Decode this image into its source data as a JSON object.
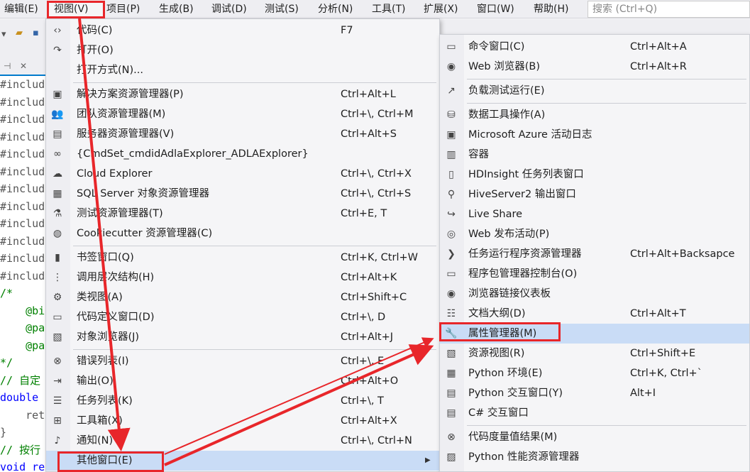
{
  "menubar": {
    "items": [
      {
        "label": "编辑(E)"
      },
      {
        "label": "视图(V)"
      },
      {
        "label": "项目(P)"
      },
      {
        "label": "生成(B)"
      },
      {
        "label": "调试(D)"
      },
      {
        "label": "测试(S)"
      },
      {
        "label": "分析(N)"
      },
      {
        "label": "工具(T)"
      },
      {
        "label": "扩展(X)"
      },
      {
        "label": "窗口(W)"
      },
      {
        "label": "帮助(H)"
      }
    ],
    "search_placeholder": "搜索 (Ctrl+Q)"
  },
  "doc_tab": {
    "pin_glyph": "⊣",
    "close_glyph": "✕"
  },
  "code_lines": [
    "#include",
    "#include",
    "#include",
    "#include",
    "#include",
    "#include",
    "#include",
    "#include",
    "#include",
    "#include",
    "#include",
    "#include",
    "/*",
    "    @bi",
    "    @pa",
    "    @pa",
    "*/",
    "// 自定",
    "double",
    "    ret",
    "}",
    "// 按行",
    "void re"
  ],
  "view_menu": {
    "items": [
      {
        "icon": "code-icon",
        "glyph": "‹›",
        "label": "代码(C)",
        "shortcut": "F7"
      },
      {
        "icon": "open-icon",
        "glyph": "↷",
        "label": "打开(O)",
        "shortcut": ""
      },
      {
        "icon": "",
        "glyph": "",
        "label": "打开方式(N)...",
        "shortcut": ""
      },
      {
        "icon": "solution-explorer-icon",
        "glyph": "▣",
        "label": "解决方案资源管理器(P)",
        "shortcut": "Ctrl+Alt+L"
      },
      {
        "icon": "team-explorer-icon",
        "glyph": "👥",
        "label": "团队资源管理器(M)",
        "shortcut": "Ctrl+\\, Ctrl+M"
      },
      {
        "icon": "server-explorer-icon",
        "glyph": "▤",
        "label": "服务器资源管理器(V)",
        "shortcut": "Ctrl+Alt+S"
      },
      {
        "icon": "adla-explorer-icon",
        "glyph": "∞",
        "label": "{CmdSet_cmdidAdlaExplorer_ADLAExplorer}",
        "shortcut": ""
      },
      {
        "icon": "cloud-icon",
        "glyph": "☁",
        "label": "Cloud Explorer",
        "shortcut": "Ctrl+\\, Ctrl+X"
      },
      {
        "icon": "sql-server-icon",
        "glyph": "▦",
        "label": "SQL Server 对象资源管理器",
        "shortcut": "Ctrl+\\, Ctrl+S"
      },
      {
        "icon": "test-explorer-icon",
        "glyph": "⚗",
        "label": "测试资源管理器(T)",
        "shortcut": "Ctrl+E, T"
      },
      {
        "icon": "cookiecutter-icon",
        "glyph": "◍",
        "label": "Cookiecutter 资源管理器(C)",
        "shortcut": ""
      },
      {
        "icon": "bookmark-icon",
        "glyph": "▮",
        "label": "书签窗口(Q)",
        "shortcut": "Ctrl+K, Ctrl+W"
      },
      {
        "icon": "call-hierarchy-icon",
        "glyph": "⋮",
        "label": "调用层次结构(H)",
        "shortcut": "Ctrl+Alt+K"
      },
      {
        "icon": "class-view-icon",
        "glyph": "⚙",
        "label": "类视图(A)",
        "shortcut": "Ctrl+Shift+C"
      },
      {
        "icon": "code-definition-icon",
        "glyph": "▭",
        "label": "代码定义窗口(D)",
        "shortcut": "Ctrl+\\, D"
      },
      {
        "icon": "object-browser-icon",
        "glyph": "▧",
        "label": "对象浏览器(J)",
        "shortcut": "Ctrl+Alt+J"
      },
      {
        "icon": "error-list-icon",
        "glyph": "⊗",
        "label": "错误列表(I)",
        "shortcut": "Ctrl+\\, E"
      },
      {
        "icon": "output-icon",
        "glyph": "⇥",
        "label": "输出(O)",
        "shortcut": "Ctrl+Alt+O"
      },
      {
        "icon": "task-list-icon",
        "glyph": "☰",
        "label": "任务列表(K)",
        "shortcut": "Ctrl+\\, T"
      },
      {
        "icon": "toolbox-icon",
        "glyph": "⊞",
        "label": "工具箱(X)",
        "shortcut": "Ctrl+Alt+X"
      },
      {
        "icon": "notification-bell-icon",
        "glyph": "♪",
        "label": "通知(N)",
        "shortcut": "Ctrl+\\, Ctrl+N"
      },
      {
        "icon": "",
        "glyph": "",
        "label": "其他窗口(E)",
        "shortcut": "",
        "submenu": true,
        "arrow": "▶"
      }
    ]
  },
  "other_windows_menu": {
    "items": [
      {
        "icon": "command-window-icon",
        "glyph": "▭",
        "label": "命令窗口(C)",
        "shortcut": "Ctrl+Alt+A"
      },
      {
        "icon": "web-browser-icon",
        "glyph": "◉",
        "label": "Web 浏览器(B)",
        "shortcut": "Ctrl+Alt+R"
      },
      {
        "icon": "load-test-icon",
        "glyph": "↗",
        "label": "负载测试运行(E)",
        "shortcut": ""
      },
      {
        "icon": "data-tools-icon",
        "glyph": "⛁",
        "label": "数据工具操作(A)",
        "shortcut": ""
      },
      {
        "icon": "azure-log-icon",
        "glyph": "▣",
        "label": "Microsoft Azure 活动日志",
        "shortcut": ""
      },
      {
        "icon": "container-icon",
        "glyph": "▥",
        "label": "容器",
        "shortcut": ""
      },
      {
        "icon": "hdinsight-icon",
        "glyph": "▯",
        "label": "HDInsight 任务列表窗口",
        "shortcut": ""
      },
      {
        "icon": "hiveserver-icon",
        "glyph": "⚲",
        "label": "HiveServer2 输出窗口",
        "shortcut": ""
      },
      {
        "icon": "live-share-icon",
        "glyph": "↪",
        "label": "Live Share",
        "shortcut": ""
      },
      {
        "icon": "web-publish-icon",
        "glyph": "◎",
        "label": "Web 发布活动(P)",
        "shortcut": ""
      },
      {
        "icon": "task-runner-icon",
        "glyph": "❯",
        "label": "任务运行程序资源管理器",
        "shortcut": "Ctrl+Alt+Backsapce"
      },
      {
        "icon": "package-console-icon",
        "glyph": "▭",
        "label": "程序包管理器控制台(O)",
        "shortcut": ""
      },
      {
        "icon": "browser-link-icon",
        "glyph": "◉",
        "label": "浏览器链接仪表板",
        "shortcut": ""
      },
      {
        "icon": "document-outline-icon",
        "glyph": "☷",
        "label": "文档大纲(D)",
        "shortcut": "Ctrl+Alt+T"
      },
      {
        "icon": "wrench-icon",
        "glyph": "🔧",
        "label": "属性管理器(M)",
        "shortcut": ""
      },
      {
        "icon": "resource-view-icon",
        "glyph": "▧",
        "label": "资源视图(R)",
        "shortcut": "Ctrl+Shift+E"
      },
      {
        "icon": "python-env-icon",
        "glyph": "▦",
        "label": "Python 环境(E)",
        "shortcut": "Ctrl+K, Ctrl+`"
      },
      {
        "icon": "python-interactive-icon",
        "glyph": "▤",
        "label": "Python 交互窗口(Y)",
        "shortcut": "Alt+I"
      },
      {
        "icon": "csharp-interactive-icon",
        "glyph": "▤",
        "label": "C# 交互窗口",
        "shortcut": ""
      },
      {
        "icon": "code-metrics-icon",
        "glyph": "⊗",
        "label": "代码度量值结果(M)",
        "shortcut": ""
      },
      {
        "icon": "python-profiler-icon",
        "glyph": "▨",
        "label": "Python 性能资源管理器",
        "shortcut": ""
      }
    ]
  },
  "colors": {
    "highlight": "#c9dcf6",
    "annotation": "#e8262a",
    "accent": "#007acc"
  }
}
